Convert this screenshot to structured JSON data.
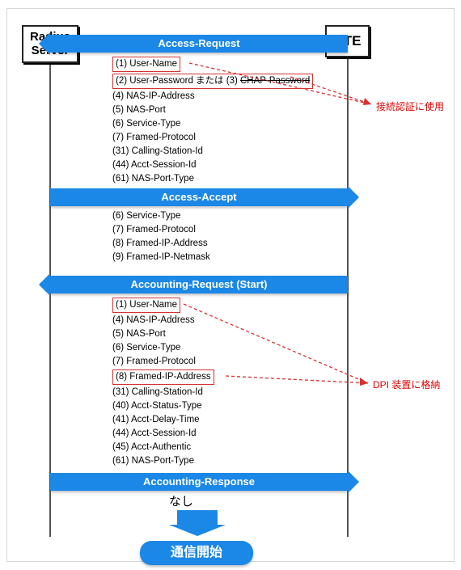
{
  "endpoints": {
    "left": "Radius\nServer",
    "right": "NTE"
  },
  "messages": [
    {
      "label": "Access-Request",
      "direction": "left",
      "attrs": [
        "(1) User-Name",
        "(2) User-Password または (3) CHAP-Password",
        "(4) NAS-IP-Address",
        "(5) NAS-Port",
        "(6) Service-Type",
        "(7) Framed-Protocol",
        "(31) Calling-Station-Id",
        "(44) Acct-Session-Id",
        "(61) NAS-Port-Type"
      ],
      "boxed_idx": [
        0,
        1
      ],
      "strike_chap": true,
      "note": "接続認証に使用"
    },
    {
      "label": "Access-Accept",
      "direction": "right",
      "attrs": [
        "(6) Service-Type",
        "(7) Framed-Protocol",
        "(8) Framed-IP-Address",
        "(9) Framed-IP-Netmask"
      ],
      "boxed_idx": []
    },
    {
      "label": "Accounting-Request (Start)",
      "direction": "left",
      "attrs": [
        "(1) User-Name",
        "(4) NAS-IP-Address",
        "(5) NAS-Port",
        "(6) Service-Type",
        "(7) Framed-Protocol",
        "(8) Framed-IP-Address",
        "(31) Calling-Station-Id",
        "(40) Acct-Status-Type",
        "(41) Acct-Delay-Time",
        "(44) Acct-Session-Id",
        "(45) Acct-Authentic",
        "(61) NAS-Port-Type"
      ],
      "boxed_idx": [
        0,
        5
      ],
      "note": "DPI 装置に格納"
    },
    {
      "label": "Accounting-Response",
      "direction": "right",
      "attrs": [],
      "post": "なし"
    }
  ],
  "final": "通信開始",
  "colors": {
    "accent": "#1b87e6",
    "highlight": "#d93030"
  }
}
